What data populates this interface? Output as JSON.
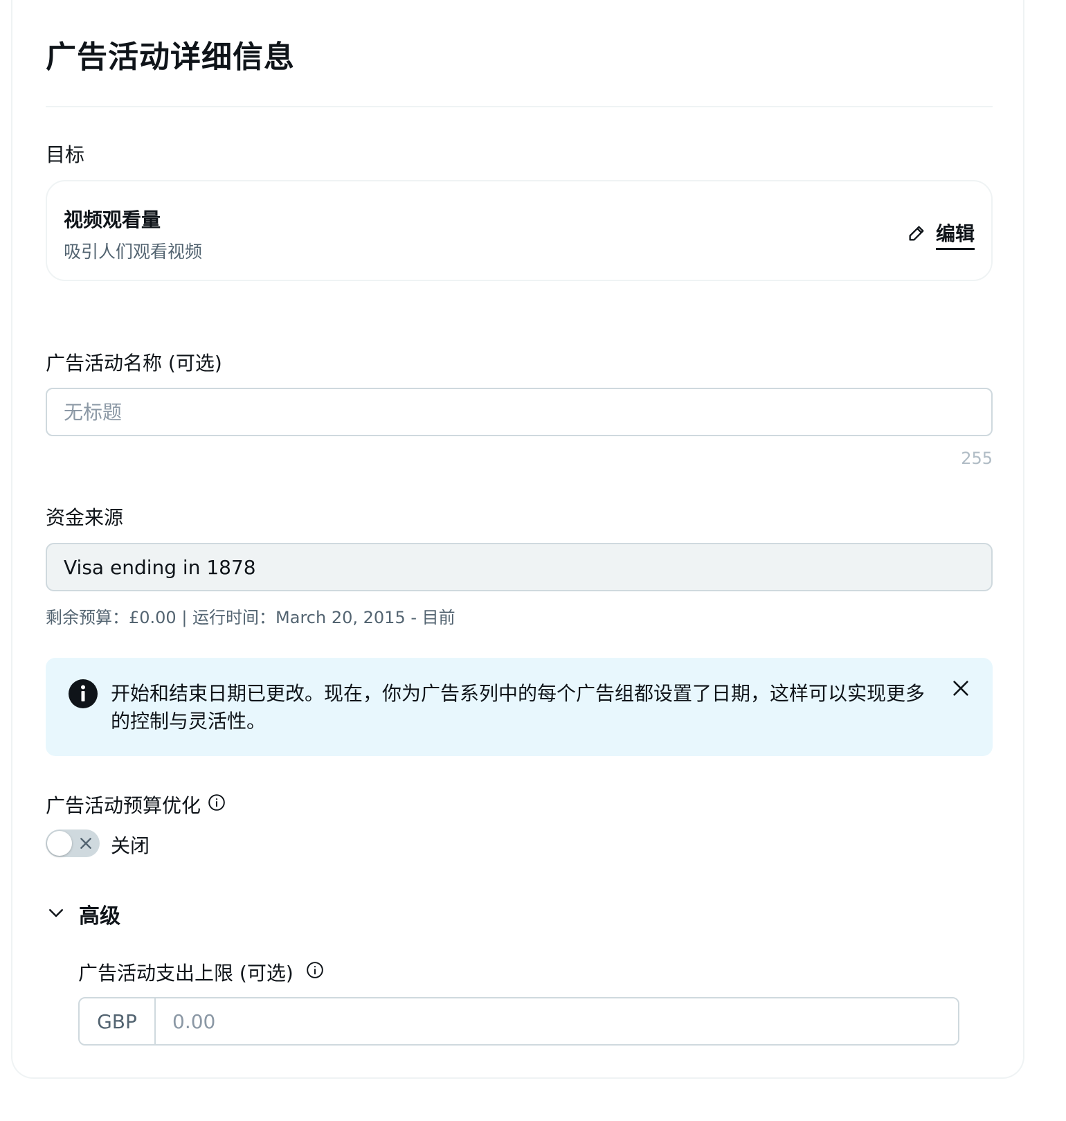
{
  "page": {
    "title": "广告活动详细信息"
  },
  "goal": {
    "label": "目标",
    "title": "视频观看量",
    "subtitle": "吸引人们观看视频",
    "edit_label": "编辑"
  },
  "campaign_name": {
    "label": "广告活动名称 (可选)",
    "value": "",
    "placeholder": "无标题",
    "char_limit": "255"
  },
  "funding": {
    "label": "资金来源",
    "selected": "Visa ending in 1878",
    "helper": "剩余预算：£0.00 | 运行时间：March 20, 2015 - 目前"
  },
  "info_banner": {
    "text": "开始和结束日期已更改。现在，你为广告系列中的每个广告组都设置了日期，这样可以实现更多的控制与灵活性。"
  },
  "budget_optimization": {
    "label": "广告活动预算优化",
    "toggle_state": "关闭",
    "enabled": false
  },
  "advanced": {
    "label": "高级",
    "expanded": true,
    "spend_cap": {
      "label": "广告活动支出上限 (可选)",
      "currency": "GBP",
      "placeholder": "0.00",
      "value": ""
    }
  },
  "colors": {
    "text": "#0f1419",
    "muted": "#536471",
    "border": "#cfd9de",
    "info_bg": "#e8f7fd",
    "disabled_bg": "#eff3f4"
  }
}
